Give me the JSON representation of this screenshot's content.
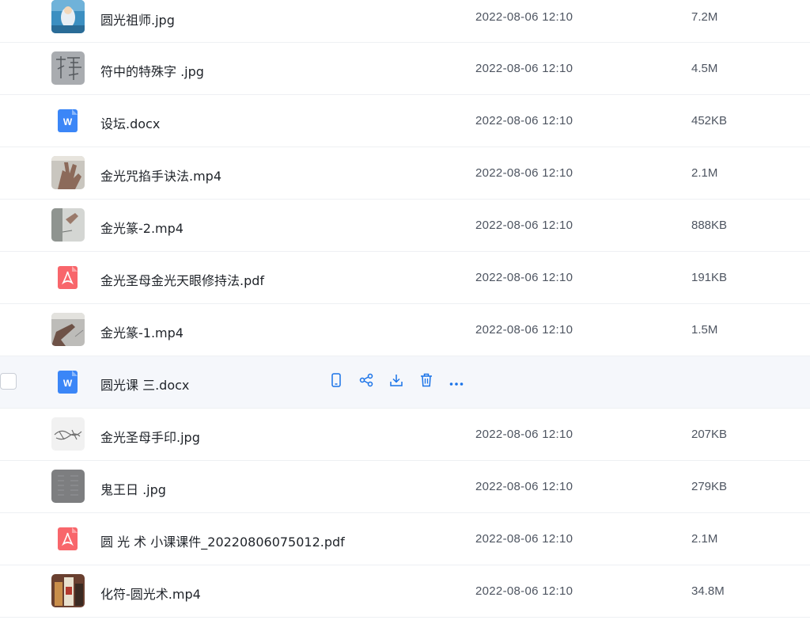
{
  "colors": {
    "accent": "#1a73e8",
    "word": "#3b86f7",
    "pdf": "#f8666b",
    "text": "#1f2329",
    "meta": "#4e5561"
  },
  "files": [
    {
      "name": "圆光祖师.jpg",
      "date": "2022-08-06 12:10",
      "size": "7.2M",
      "kind": "image",
      "thumb": "blue-figure"
    },
    {
      "name": "符中的特殊字 .jpg",
      "date": "2022-08-06 12:10",
      "size": "4.5M",
      "kind": "image",
      "thumb": "handwriting"
    },
    {
      "name": "设坛.docx",
      "date": "2022-08-06 12:10",
      "size": "452KB",
      "kind": "word",
      "thumb": "word-icon"
    },
    {
      "name": "金光咒掐手诀法.mp4",
      "date": "2022-08-06 12:10",
      "size": "2.1M",
      "kind": "video",
      "thumb": "hand"
    },
    {
      "name": "金光篆-2.mp4",
      "date": "2022-08-06 12:10",
      "size": "888KB",
      "kind": "video",
      "thumb": "paper-hand"
    },
    {
      "name": "金光圣母金光天眼修持法.pdf",
      "date": "2022-08-06 12:10",
      "size": "191KB",
      "kind": "pdf",
      "thumb": "pdf-icon"
    },
    {
      "name": "金光篆-1.mp4",
      "date": "2022-08-06 12:10",
      "size": "1.5M",
      "kind": "video",
      "thumb": "finger"
    },
    {
      "name": "圆光课 三.docx",
      "date": "",
      "size": "",
      "kind": "word",
      "thumb": "word-icon",
      "hovered": true
    },
    {
      "name": "金光圣母手印.jpg",
      "date": "2022-08-06 12:10",
      "size": "207KB",
      "kind": "image",
      "thumb": "sketch"
    },
    {
      "name": "鬼王日 .jpg",
      "date": "2022-08-06 12:10",
      "size": "279KB",
      "kind": "image",
      "thumb": "grey-doc"
    },
    {
      "name": "圆 光 术 小课课件_20220806075012.pdf",
      "date": "2022-08-06 12:10",
      "size": "2.1M",
      "kind": "pdf",
      "thumb": "pdf-icon"
    },
    {
      "name": "化符-圆光术.mp4",
      "date": "2022-08-06 12:10",
      "size": "34.8M",
      "kind": "video",
      "thumb": "bottles"
    }
  ],
  "row_actions": [
    {
      "icon": "phone-icon"
    },
    {
      "icon": "share-icon"
    },
    {
      "icon": "download-icon"
    },
    {
      "icon": "trash-icon"
    },
    {
      "icon": "more-icon"
    }
  ]
}
